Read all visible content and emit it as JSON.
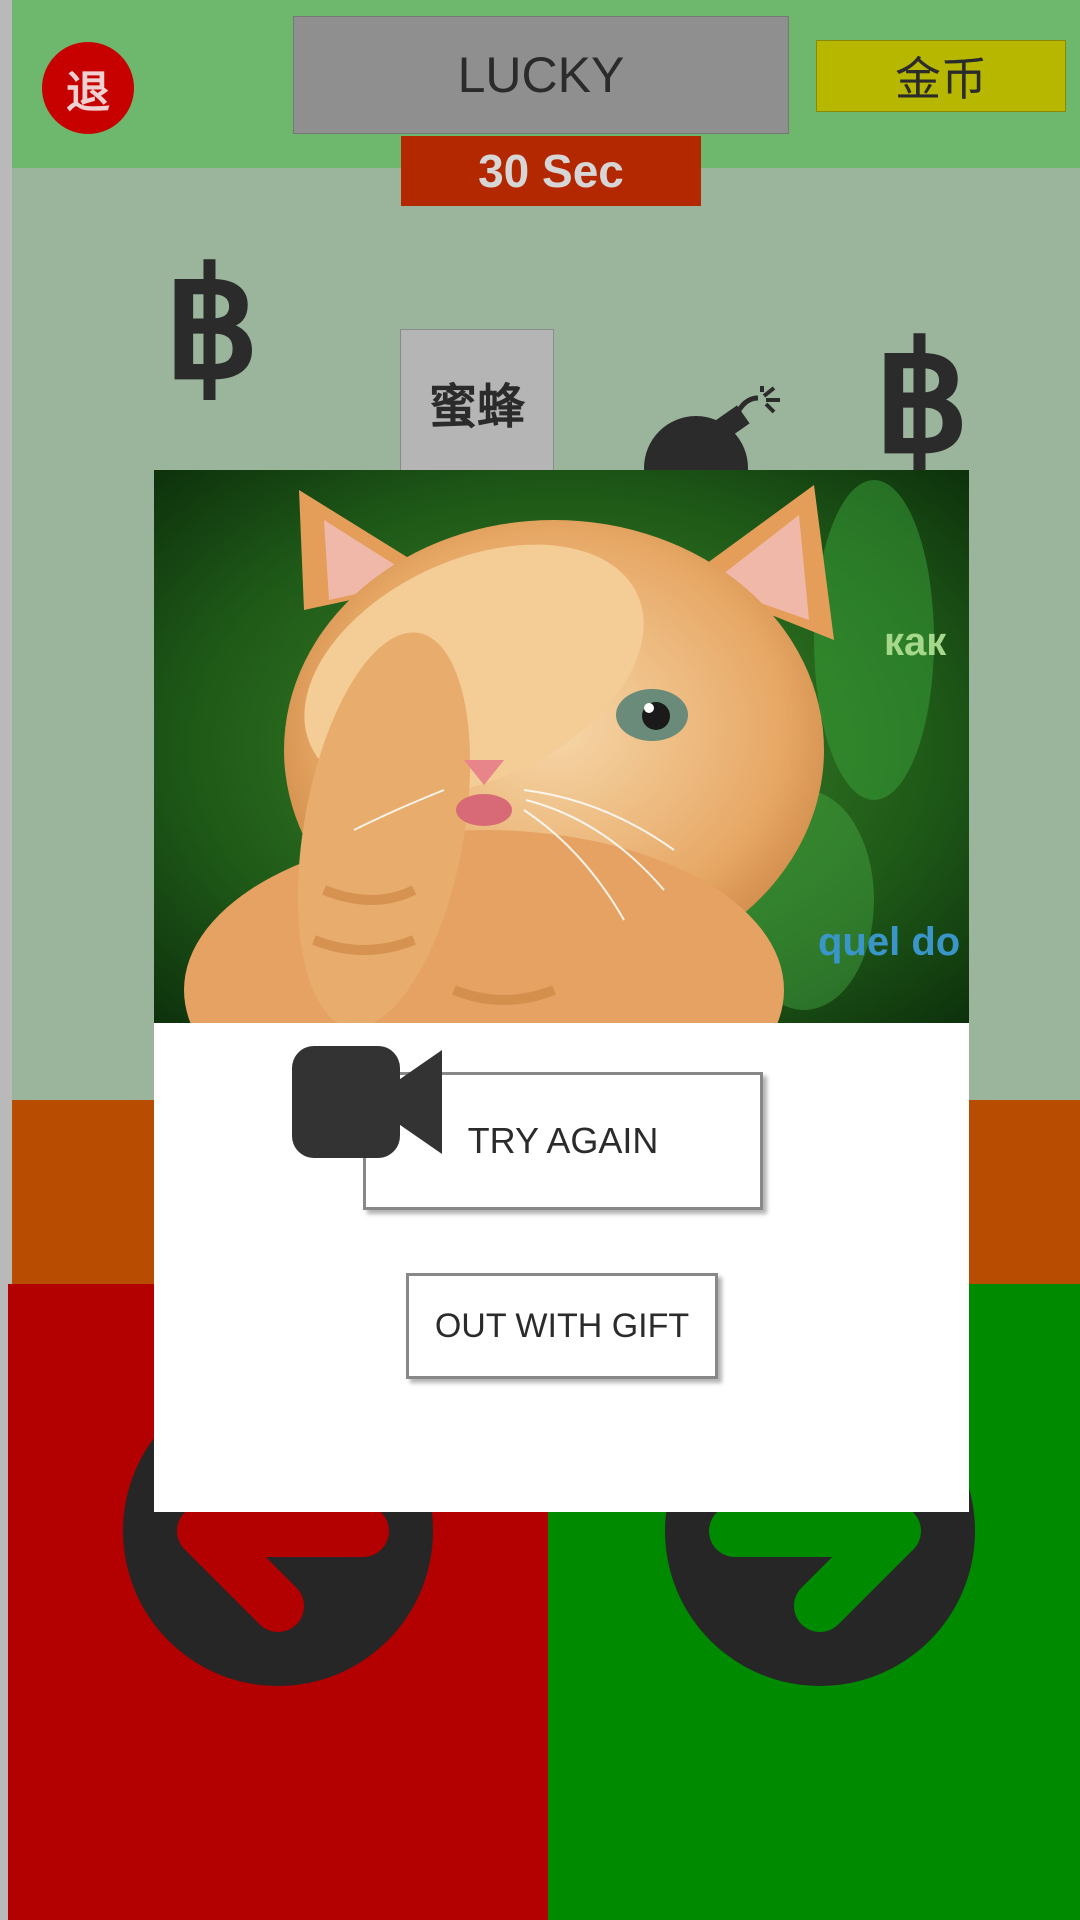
{
  "header": {
    "exit_label": "退",
    "title": "LUCKY",
    "coins_label": "金币",
    "timer": "30 Sec"
  },
  "board": {
    "bee_label": "蜜蜂",
    "coin_symbol": "฿",
    "icons": [
      "bitcoin-icon",
      "bitcoin-icon",
      "bomb-icon",
      "arrow-left-icon",
      "arrow-right-icon"
    ]
  },
  "dialog": {
    "caption_right": "как",
    "caption_bottom": "quel do",
    "try_again_label": "TRY AGAIN",
    "out_label": "OUT WITH GIFT"
  },
  "colors": {
    "topbar": "#6db86d",
    "playfield": "#9bb59c",
    "timer": "#b42800",
    "coin_box": "#b7b700",
    "left_panel": "#b30000",
    "right_panel": "#008a00",
    "orange_strip": "#b84c00"
  }
}
